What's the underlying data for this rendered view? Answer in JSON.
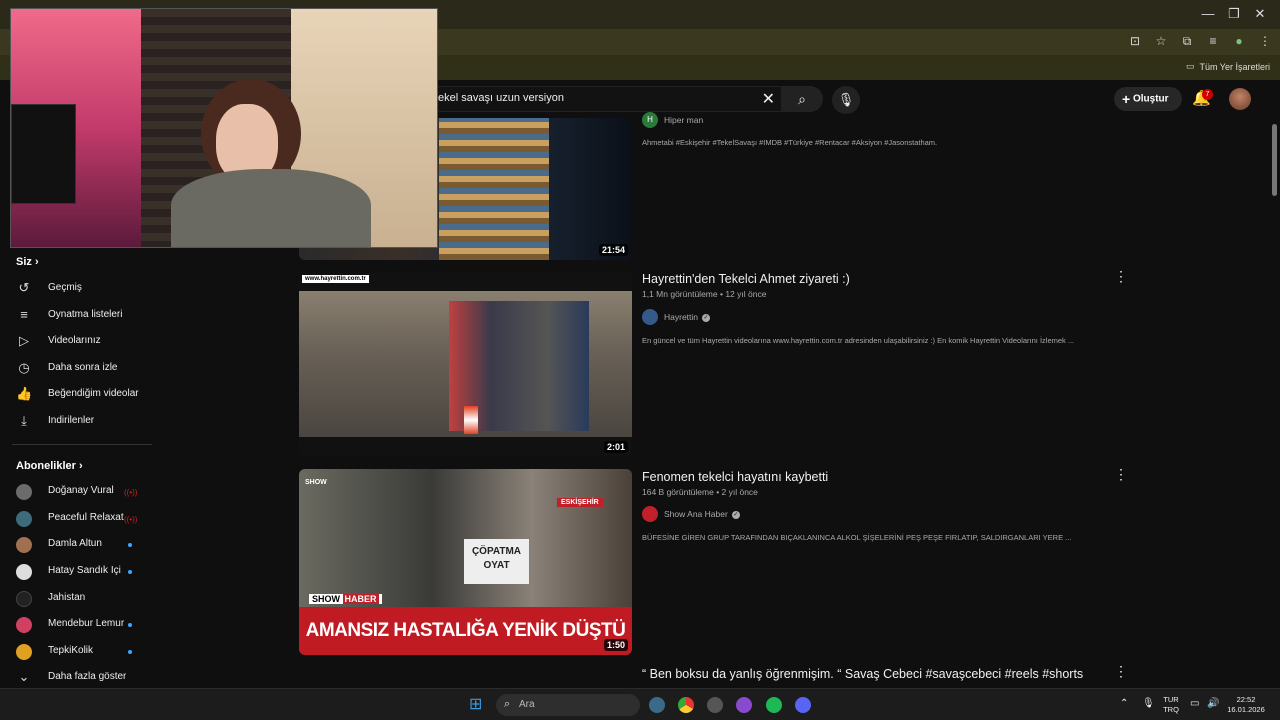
{
  "search": {
    "query": "ekel savaşı uzun versiyon"
  },
  "header": {
    "create_label": "Oluştur",
    "notif_count": "7"
  },
  "bookmarks": {
    "all_label": "Tüm Yer İşaretleri"
  },
  "sidebar": {
    "you_heading": "Siz",
    "you_items": [
      {
        "label": "Geçmiş",
        "icon": "history-icon"
      },
      {
        "label": "Oynatma listeleri",
        "icon": "playlist-icon"
      },
      {
        "label": "Videolarınız",
        "icon": "your-videos-icon"
      },
      {
        "label": "Daha sonra izle",
        "icon": "watch-later-icon"
      },
      {
        "label": "Beğendiğim videolar",
        "icon": "like-icon"
      },
      {
        "label": "İndirilenler",
        "icon": "download-icon"
      }
    ],
    "subs_heading": "Abonelikler",
    "subs": [
      {
        "label": "Doğanay Vural",
        "status": "live",
        "color": "#6b6b6b"
      },
      {
        "label": "Peaceful Relaxat...",
        "status": "live",
        "color": "#3d6b7a"
      },
      {
        "label": "Damla Altun",
        "status": "new",
        "color": "#a07050"
      },
      {
        "label": "Hatay Sandık İçi",
        "status": "new",
        "color": "#dddddd"
      },
      {
        "label": "Jahistan",
        "status": "",
        "color": "#222222"
      },
      {
        "label": "Mendebur Lemur",
        "status": "new",
        "color": "#d04060"
      },
      {
        "label": "TepkiKolik",
        "status": "new",
        "color": "#e0a020"
      }
    ],
    "show_more": "Daha fazla göster"
  },
  "videos": [
    {
      "title": "",
      "views": "",
      "age": "",
      "channel": "Hiper man",
      "verified": false,
      "desc": "Ahmetabi #Eskişehir #TekelSavaşı #IMDB #Türkiye #Rentacar #Aksiyon #Jasonstatham.",
      "duration": "21:54",
      "channel_color": "#2a7a3a",
      "channel_initial": "H"
    },
    {
      "title": "Hayrettin'den Tekelci Ahmet ziyareti :)",
      "views": "1,1 Mn görüntüleme",
      "age": "12 yıl önce",
      "channel": "Hayrettin",
      "verified": true,
      "desc": "En güncel ve tüm Hayrettin videolarına www.hayrettin.com.tr adresinden ulaşabilirsiniz :) En komik Hayrettin Videolarını İzlemek ...",
      "duration": "2:01",
      "channel_color": "#345a8a",
      "thumb_caption": "www.hayrettin.com.tr"
    },
    {
      "title": "Fenomen tekelci hayatını kaybetti",
      "views": "164 B görüntüleme",
      "age": "2 yıl önce",
      "channel": "Show Ana Haber",
      "verified": true,
      "desc": "BÜFESİNE GİREN GRUP TARAFINDAN BIÇAKLANINCA ALKOL ŞİŞELERİNİ PEŞ PEŞE FIRLATIP, SALDIRGANLARI YERE ...",
      "duration": "1:50",
      "channel_color": "#c0202a",
      "banner": "AMANSIZ HASTALIĞA YENİK DÜŞTÜ",
      "show_tag": "SHOW",
      "haber_tag": "HABER",
      "city_tag": "ESKİŞEHİR",
      "sign_text": "ÇÖPATMA OYAT"
    },
    {
      "title": "“ Ben boksu da yanlış öğrenmişim. “ Savaş Cebeci #savaşcebeci #reels #shorts",
      "views": "",
      "age": "",
      "channel": "",
      "verified": false,
      "desc": "",
      "duration": ""
    }
  ],
  "taskbar": {
    "search_placeholder": "Ara",
    "lang_top": "TUR",
    "lang_bottom": "TRQ",
    "time": "22:52",
    "date": "16.01.2026"
  }
}
